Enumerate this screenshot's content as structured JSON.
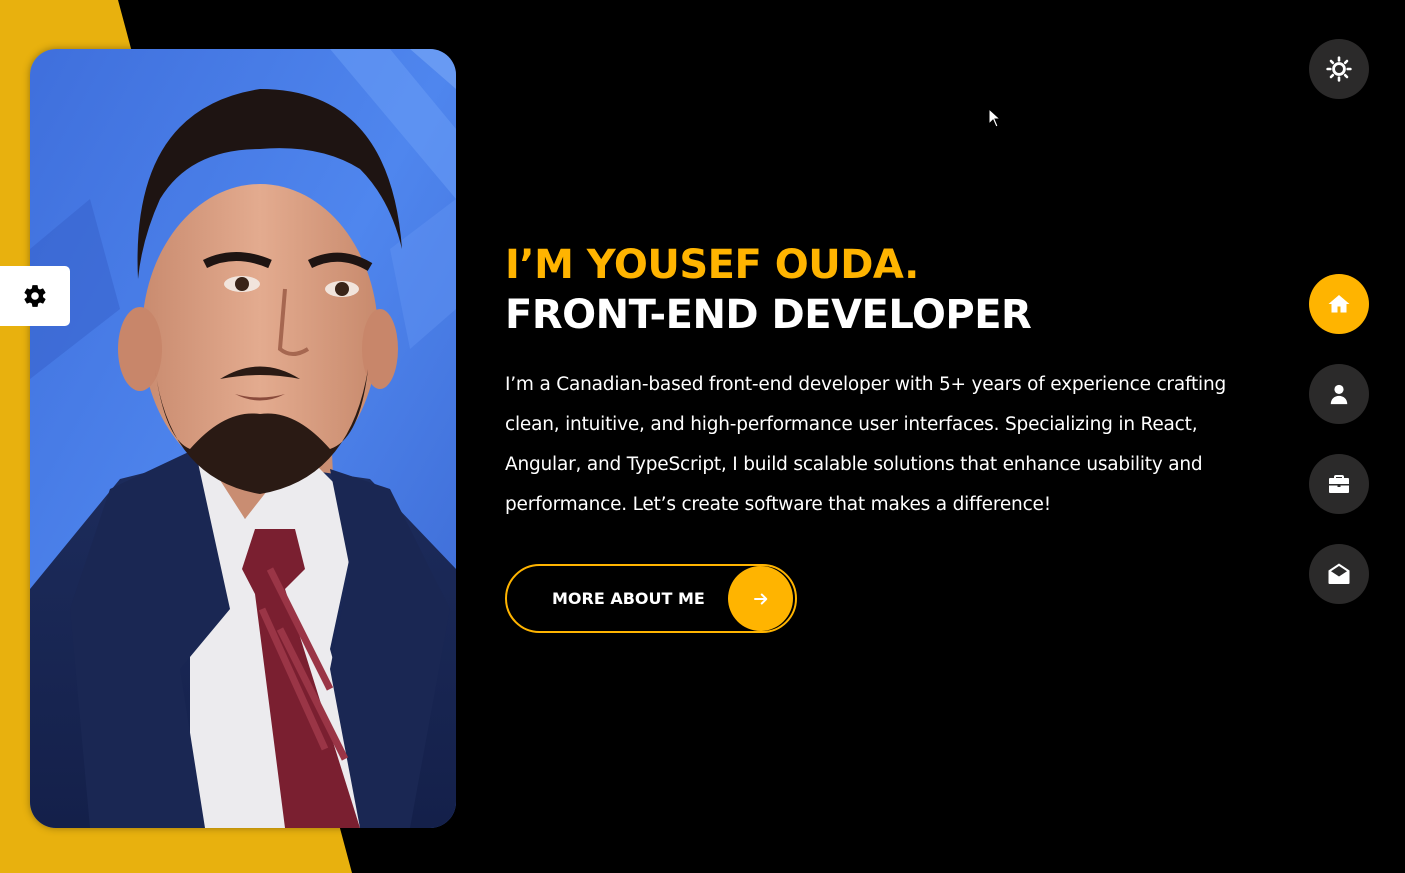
{
  "hero": {
    "name_line": "I’M YOUSEF OUDA.",
    "role_line": "FRONT-END DEVELOPER",
    "description": "I’m a Canadian-based front-end developer with 5+ years of experience crafting clean, intuitive, and high-performance user interfaces. Specializing in React, Angular, and TypeScript, I build scalable solutions that enhance usability and performance. Let’s create software that makes a difference!"
  },
  "cta": {
    "label": "MORE ABOUT ME",
    "icon": "arrow-right-icon"
  },
  "settings": {
    "icon": "gear-icon"
  },
  "theme_toggle": {
    "icon": "sun-icon"
  },
  "side_nav": {
    "items": [
      {
        "icon": "home-icon",
        "active": true
      },
      {
        "icon": "user-icon",
        "active": false
      },
      {
        "icon": "briefcase-icon",
        "active": false
      },
      {
        "icon": "envelope-open-icon",
        "active": false
      }
    ]
  },
  "colors": {
    "accent": "#ffb400",
    "background": "#000000",
    "button_dark": "#2b2a2a",
    "text": "#ffffff"
  }
}
